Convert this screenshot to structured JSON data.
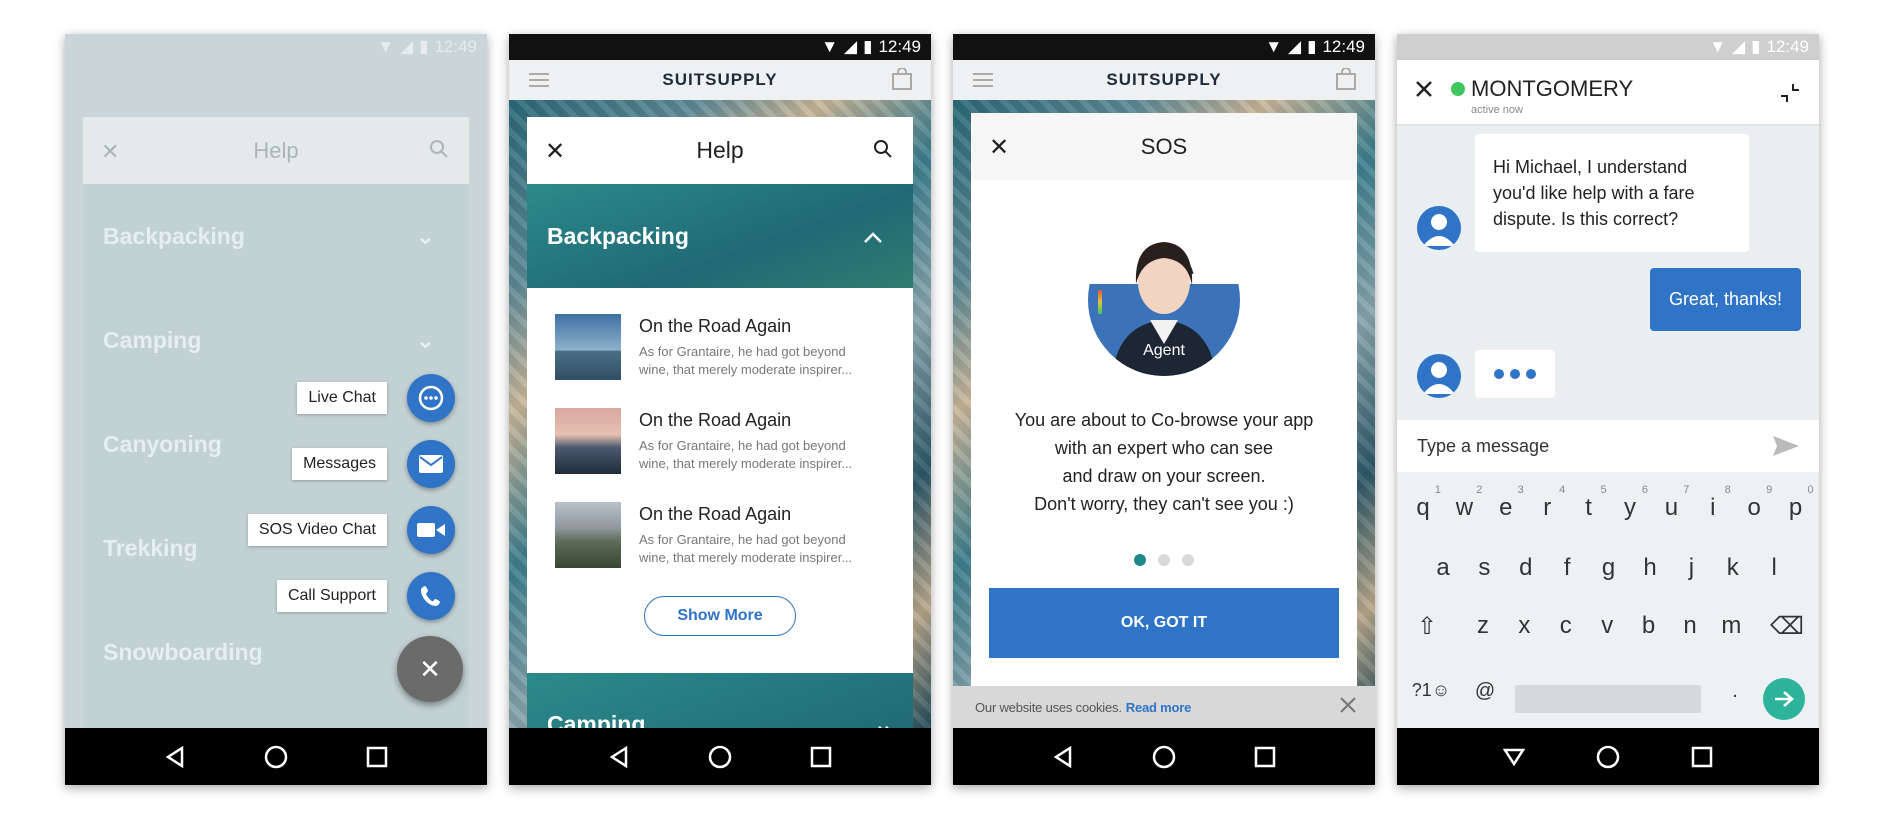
{
  "status_time": "12:49",
  "brand": "SUITSUPPLY",
  "phone1": {
    "help_title": "Help",
    "categories": [
      "Backpacking",
      "Camping",
      "Canyoning",
      "Trekking",
      "Snowboarding"
    ],
    "fab_actions": [
      "Live Chat",
      "Messages",
      "SOS Video Chat",
      "Call Support"
    ],
    "icons": [
      "chat-bubble-icon",
      "envelope-icon",
      "video-camera-icon",
      "phone-icon",
      "close-icon"
    ]
  },
  "phone2": {
    "help_title": "Help",
    "expanded_category": "Backpacking",
    "next_category": "Camping",
    "articles": [
      {
        "title": "On the Road Again",
        "desc": "As for Grantaire, he had got beyond wine, that merely moderate inspirer..."
      },
      {
        "title": "On the Road Again",
        "desc": "As for Grantaire, he had got beyond wine, that merely moderate inspirer..."
      },
      {
        "title": "On the Road Again",
        "desc": "As for Grantaire, he had got beyond wine, that merely moderate inspirer..."
      }
    ],
    "show_more": "Show More"
  },
  "phone3": {
    "modal_title": "SOS",
    "agent_label": "Agent",
    "lines": [
      "You are about to Co-browse your app",
      "with an expert who can see",
      "and draw on your screen.",
      "Don't worry, they can't see you :)"
    ],
    "ok_button": "OK, GOT IT",
    "cookie_text": "Our website uses cookies.",
    "cookie_link": "Read more",
    "carousel_active": 1
  },
  "phone4": {
    "agent_name": "MONTGOMERY",
    "agent_status": "active now",
    "message_in": "Hi Michael, I understand you'd like help with a fare dispute. Is this correct?",
    "message_out": "Great, thanks!",
    "input_placeholder": "Type a message",
    "keyboard": {
      "row1": [
        "q",
        "w",
        "e",
        "r",
        "t",
        "y",
        "u",
        "i",
        "o",
        "p"
      ],
      "row1_nums": [
        "1",
        "2",
        "3",
        "4",
        "5",
        "6",
        "7",
        "8",
        "9",
        "0"
      ],
      "row2": [
        "a",
        "s",
        "d",
        "f",
        "g",
        "h",
        "j",
        "k",
        "l"
      ],
      "row3": [
        "z",
        "x",
        "c",
        "v",
        "b",
        "n",
        "m"
      ],
      "sym_key": "?1☺",
      "at_key": "@",
      "dot_key": "."
    }
  },
  "colors": {
    "primary": "#2f74c7",
    "teal": "#1f6a76",
    "online": "#3cc65c",
    "enter": "#2db39a"
  }
}
